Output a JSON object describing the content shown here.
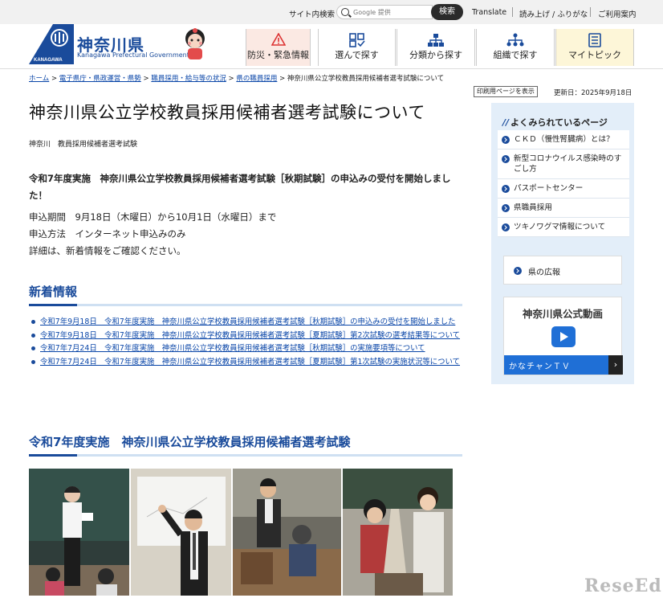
{
  "utility": {
    "site_search_label": "サイト内検索",
    "search_placeholder": "Google 提供",
    "search_button": "検索",
    "translate": "Translate",
    "read_aloud": "読み上げ / ふりがな",
    "usage_guide": "ご利用案内"
  },
  "header": {
    "logo_title": "神奈川県",
    "logo_sub": "Kanagawa Prefectural Government",
    "logo_mark_text": "KANAGAWA",
    "nav": [
      {
        "label": "防災・緊急情報",
        "icon": "warning-icon"
      },
      {
        "label": "選んで探す",
        "icon": "grid-select-icon"
      },
      {
        "label": "分類から探す",
        "icon": "category-tree-icon"
      },
      {
        "label": "組織で探す",
        "icon": "organization-icon"
      },
      {
        "label": "マイトピック",
        "icon": "mytopic-icon"
      }
    ]
  },
  "breadcrumb": {
    "items": [
      "ホーム",
      "電子県庁・県政運営・県勢",
      "職員採用・給与等の状況",
      "県の職員採用"
    ],
    "current": "神奈川県公立学校教員採用候補者選考試験について"
  },
  "page": {
    "print_button": "印刷用ページを表示",
    "updated": "更新日：2025年9月18日",
    "title": "神奈川県公立学校教員採用候補者選考試験について",
    "subtitle": "神奈川　教員採用候補者選考試験",
    "announcement": "令和7年度実施　神奈川県公立学校教員採用候補者選考試験［秋期試験］の申込みの受付を開始しました！",
    "detail_lines": [
      "申込期間　9月18日（木曜日）から10月1日（水曜日）まで",
      "申込方法　インターネット申込みのみ",
      "詳細は、新着情報をご確認ください。"
    ],
    "news_heading": "新着情報",
    "news": [
      "令和7年9月18日　令和7年度実施　神奈川県公立学校教員採用候補者選考試験［秋期試験］の申込みの受付を開始しました",
      "令和7年9月18日　令和7年度実施　神奈川県公立学校教員採用候補者選考試験［夏期試験］第2次試験の選考結果等について",
      "令和7年7月24日　令和7年度実施　神奈川県公立学校教員採用候補者選考試験［秋期試験］の実施要項等について",
      "令和7年7月24日　令和7年度実施　神奈川県公立学校教員採用候補者選考試験［夏期試験］第1次試験の実施状況等について"
    ],
    "section2_heading": "令和7年度実施　神奈川県公立学校教員採用候補者選考試験"
  },
  "sidebar": {
    "heading": "よくみられているページ",
    "items": [
      "ＣＫＤ（慢性腎臓病）とは？",
      "新型コロナウイルス感染時のすごし方",
      "パスポートセンター",
      "県職員採用",
      "ツキノワグマ情報について"
    ],
    "kouhou": "県の広報",
    "video_title": "神奈川県公式動画",
    "video_band": "かなチャンＴＶ",
    "video_band_arrow": "›"
  },
  "watermark": "ReseEd",
  "colors": {
    "brand_blue": "#1a4b9b",
    "link_blue": "#0a46a8",
    "sidebar_bg": "#e3eef9",
    "disaster_bg": "#fbe9e3",
    "mytopic_bg": "#fdf6d8"
  }
}
